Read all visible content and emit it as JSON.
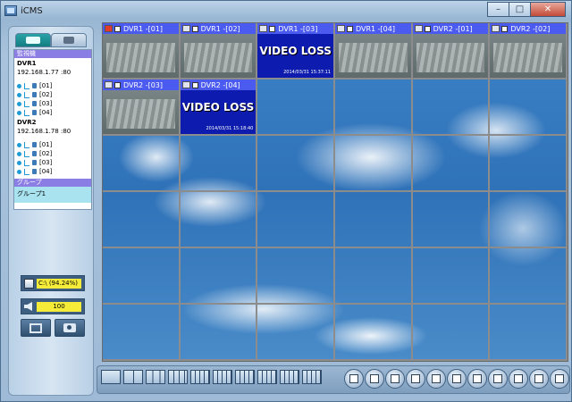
{
  "window": {
    "title": "iCMS",
    "min": "–",
    "max": "□",
    "close": "✕"
  },
  "left_panel": {
    "tree_header": "監視機",
    "dvrs": [
      {
        "name": "DVR1",
        "ip": "192.168.1.77 :80",
        "channels": [
          "[01]",
          "[02]",
          "[03]",
          "[04]"
        ]
      },
      {
        "name": "DVR2",
        "ip": "192.168.1.78 :80",
        "channels": [
          "[01]",
          "[02]",
          "[03]",
          "[04]"
        ]
      }
    ],
    "group_header": "グループ",
    "group_item": "グループ1",
    "storage": "C:\\ (94.24%)",
    "volume": "100"
  },
  "cameras": [
    {
      "label": "DVR1 -[01]",
      "type": "video",
      "alarm": true
    },
    {
      "label": "DVR1 -[02]",
      "type": "video",
      "alarm": false
    },
    {
      "label": "DVR1 -[03]",
      "type": "loss",
      "alarm": false,
      "loss_text": "VIDEO LOSS",
      "timestamp": "2014/03/31 15:37:11"
    },
    {
      "label": "DVR1 -[04]",
      "type": "video",
      "alarm": false
    },
    {
      "label": "DVR2 -[01]",
      "type": "video",
      "alarm": false
    },
    {
      "label": "DVR2 -[02]",
      "type": "video",
      "alarm": false
    },
    {
      "label": "DVR2 -[03]",
      "type": "video",
      "alarm": false
    },
    {
      "label": "DVR2 -[04]",
      "type": "loss",
      "alarm": false,
      "loss_text": "VIDEO LOSS",
      "timestamp": "2014/03/31 15:18:40"
    }
  ],
  "icons": {
    "app": "app-icon",
    "storage": "hdd-icon",
    "volume": "speaker-icon",
    "record": "film-icon",
    "snapshot": "camera-icon"
  },
  "colors": {
    "cam_bar": "#4b5bf0",
    "video_loss": "#0d1cae",
    "tree_header": "#8a7ee5",
    "group": "#a8e3ef",
    "value_box": "#f4ec38"
  }
}
